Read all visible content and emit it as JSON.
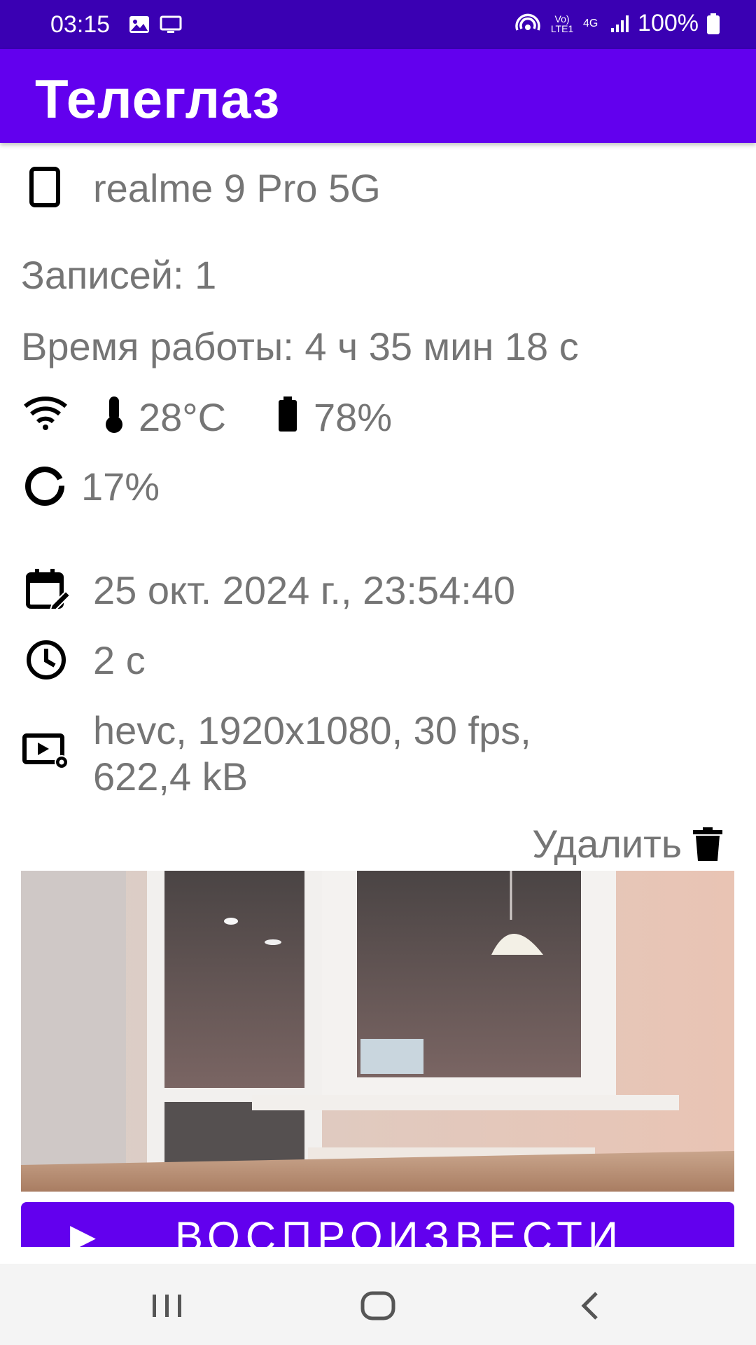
{
  "status_bar": {
    "time": "03:15",
    "left_icons": [
      "image-icon",
      "monitor-icon"
    ],
    "right_icons": [
      "hotspot-icon",
      "volte-icon",
      "4g-icon",
      "signal-icon",
      "battery-icon"
    ],
    "volte_label": "Vo) LTE1",
    "network_label": "4G",
    "battery_text": "100%"
  },
  "app_bar": {
    "title": "Телеглаз"
  },
  "device": {
    "icon": "phone-icon",
    "name": "realme 9 Pro 5G"
  },
  "stats": {
    "records": "Записей: 1",
    "uptime": "Время работы: 4 ч 35 мин 18 с",
    "temperature": "28°C",
    "battery": "78%",
    "cpu": "17%"
  },
  "recording": {
    "datetime": "25 окт. 2024 г., 23:54:40",
    "duration": "2 с",
    "video_info_line1": "hevc, 1920x1080, 30 fps,",
    "video_info_line2": "622,4 kB"
  },
  "actions": {
    "delete_label": "Удалить",
    "play_label": "ВОСПРОИЗВЕСТИ"
  },
  "colors": {
    "status_bar": "#3a00b3",
    "app_bar": "#6200ee",
    "text_secondary": "#757575",
    "button": "#6200ee"
  }
}
